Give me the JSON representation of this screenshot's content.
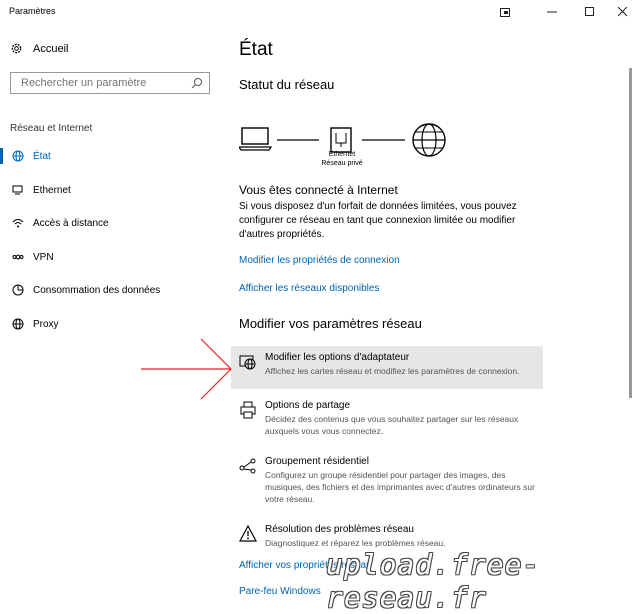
{
  "window": {
    "title": "Paramètres",
    "controls": [
      "compact-overlay",
      "minimize",
      "maximize",
      "close"
    ]
  },
  "sidebar": {
    "home_label": "Accueil",
    "search_placeholder": "Rechercher un paramètre",
    "section_label": "Réseau et Internet",
    "items": [
      {
        "label": "État",
        "icon": "status-globe-icon",
        "active": true
      },
      {
        "label": "Ethernet",
        "icon": "ethernet-icon",
        "active": false
      },
      {
        "label": "Accès à distance",
        "icon": "dialup-icon",
        "active": false
      },
      {
        "label": "VPN",
        "icon": "vpn-icon",
        "active": false
      },
      {
        "label": "Consommation des données",
        "icon": "data-usage-icon",
        "active": false
      },
      {
        "label": "Proxy",
        "icon": "proxy-globe-icon",
        "active": false
      }
    ]
  },
  "main": {
    "title": "État",
    "status_heading": "Statut du réseau",
    "diagram_caption_line1": "Ethernet",
    "diagram_caption_line2": "Réseau privé",
    "connected_heading": "Vous êtes connecté à Internet",
    "connected_text": "Si vous disposez d'un forfait de données limitées, vous pouvez configurer ce réseau en tant que connexion limitée ou modifier d'autres propriétés.",
    "link_properties": "Modifier les propriétés de connexion",
    "link_networks": "Afficher les réseaux disponibles",
    "change_heading": "Modifier vos paramètres réseau",
    "options": [
      {
        "title": "Modifier les options d'adaptateur",
        "desc": "Affichez les cartes réseau et modifiez les paramètres de connexion.",
        "icon": "adapter-globe-icon"
      },
      {
        "title": "Options de partage",
        "desc": "Décidez des contenus que vous souhaitez partager sur les réseaux auxquels vous vous connectez.",
        "icon": "sharing-printer-icon"
      },
      {
        "title": "Groupement résidentiel",
        "desc": "Configurez un groupe résidentiel pour partager des images, des musiques, des fichiers et des imprimantes avec d'autres ordinateurs sur votre réseau.",
        "icon": "homegroup-icon"
      },
      {
        "title": "Résolution des problèmes réseau",
        "desc": "Diagnostiquez et réparez les problèmes réseau.",
        "icon": "warning-icon"
      }
    ],
    "link_properties2": "Afficher vos propriétés réseau",
    "link_firewall": "Pare-feu Windows"
  },
  "watermark": "upload.free-reseau.fr",
  "colors": {
    "accent": "#0063b1",
    "hover": "#e6e6e6",
    "arrow": "#e02020"
  }
}
